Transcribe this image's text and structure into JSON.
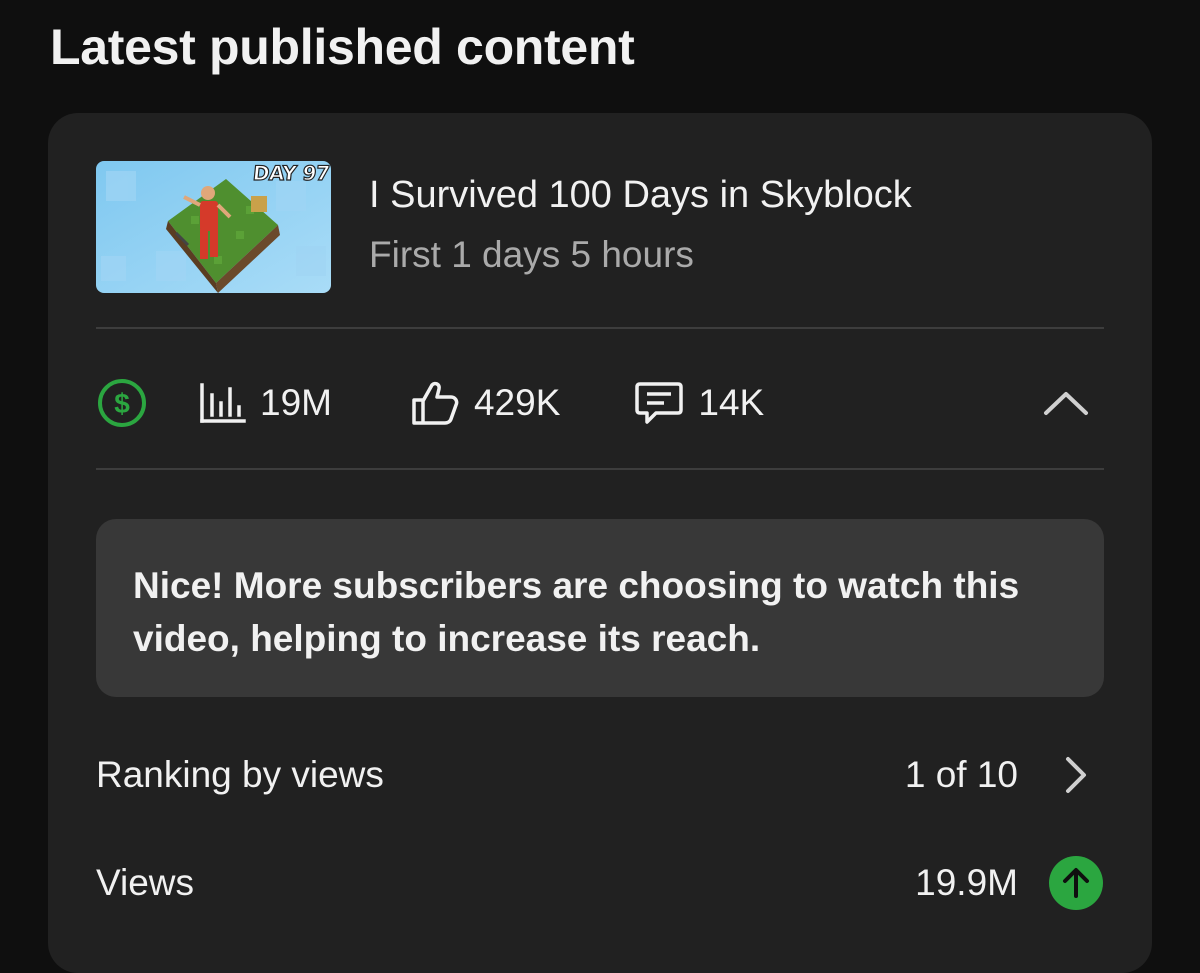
{
  "header": {
    "title": "Latest published content"
  },
  "video": {
    "title": "I Survived 100 Days in Skyblock",
    "subtitle": "First 1 days 5 hours",
    "thumbnail_badge": "DAY 97"
  },
  "stats": {
    "monetization_icon": "dollar-circle-icon",
    "views": "19M",
    "likes": "429K",
    "comments": "14K",
    "monetization_color": "#2ba640"
  },
  "insight": {
    "text": "Nice! More subscribers are choosing to watch this video, helping to increase its reach."
  },
  "metrics": [
    {
      "label": "Ranking by views",
      "value": "1 of 10",
      "action_icon": "chevron-right-icon"
    },
    {
      "label": "Views",
      "value": "19.9M",
      "action_icon": "arrow-up-icon",
      "status_color": "#2ba640"
    }
  ]
}
